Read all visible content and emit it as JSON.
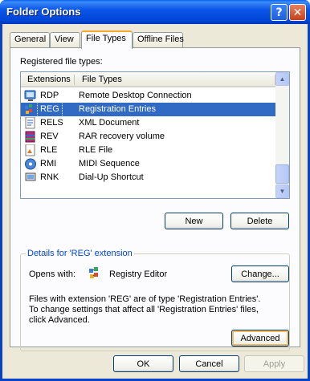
{
  "window": {
    "title": "Folder Options"
  },
  "tabs": [
    {
      "label": "General"
    },
    {
      "label": "View"
    },
    {
      "label": "File Types"
    },
    {
      "label": "Offline Files"
    }
  ],
  "file_types": {
    "label": "Registered file types:",
    "columns": [
      "Extensions",
      "File Types"
    ],
    "rows": [
      {
        "ext": "RDP",
        "type": "Remote Desktop Connection",
        "icon": "remote-desktop-icon"
      },
      {
        "ext": "REG",
        "type": "Registration Entries",
        "icon": "registry-file-icon",
        "selected": true
      },
      {
        "ext": "RELS",
        "type": "XML Document",
        "icon": "xml-document-icon"
      },
      {
        "ext": "REV",
        "type": "RAR recovery volume",
        "icon": "rar-archive-icon"
      },
      {
        "ext": "RLE",
        "type": "RLE File",
        "icon": "image-file-icon"
      },
      {
        "ext": "RMI",
        "type": "MIDI Sequence",
        "icon": "media-file-icon"
      },
      {
        "ext": "RNK",
        "type": "Dial-Up Shortcut",
        "icon": "dialup-shortcut-icon"
      }
    ]
  },
  "buttons": {
    "new": "New",
    "delete": "Delete",
    "change": "Change...",
    "advanced": "Advanced",
    "ok": "OK",
    "cancel": "Cancel",
    "apply": "Apply"
  },
  "details": {
    "label": "Details for 'REG' extension",
    "opens_with_label": "Opens with:",
    "app_name": "Registry Editor",
    "description": "Files with extension 'REG' are of type 'Registration Entries'.  To change settings that affect all 'Registration Entries' files, click Advanced."
  },
  "colors": {
    "selection": "#316ac5",
    "title_bar": "#0055e5",
    "group_label": "#0046d5",
    "default_button_ring": "#f5bb64"
  }
}
